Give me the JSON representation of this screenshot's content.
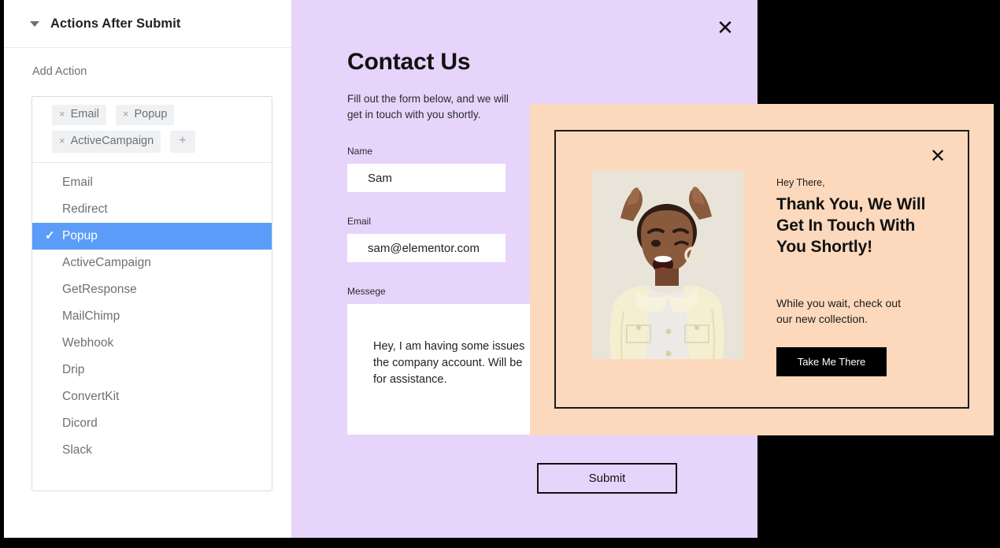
{
  "editor": {
    "header_title": "Actions After Submit",
    "caret_icon": "chevron-down-icon",
    "section_label": "Add Action",
    "tags": [
      {
        "remove_icon": "×",
        "label": "Email"
      },
      {
        "remove_icon": "×",
        "label": "Popup"
      },
      {
        "remove_icon": "×",
        "label": "ActiveCampaign"
      }
    ],
    "add_tag_label": "+",
    "options": [
      {
        "label": "Email",
        "selected": false
      },
      {
        "label": "Redirect",
        "selected": false
      },
      {
        "label": "Popup",
        "selected": true
      },
      {
        "label": "ActiveCampaign",
        "selected": false
      },
      {
        "label": "GetResponse",
        "selected": false
      },
      {
        "label": "MailChimp",
        "selected": false
      },
      {
        "label": "Webhook",
        "selected": false
      },
      {
        "label": "Drip",
        "selected": false
      },
      {
        "label": "ConvertKit",
        "selected": false
      },
      {
        "label": "Dicord",
        "selected": false
      },
      {
        "label": "Slack",
        "selected": false
      }
    ],
    "check_icon": "✓",
    "selected_highlight_color": "#5b9cf8"
  },
  "contact": {
    "background_color": "#e6d4fa",
    "close_icon": "✕",
    "title": "Contact Us",
    "subtitle": "Fill out the form below, and we will get in touch with you shortly.",
    "fields": {
      "name_label": "Name",
      "name_value": "Sam",
      "email_label": "Email",
      "email_value": "sam@elementor.com",
      "message_label": "Messege",
      "message_value": "Hey, I am having some issues with the company account. Will be needing for assistance.",
      "message_line1": "Hey, I am having some issues",
      "message_line2": "the company account. Will be",
      "message_line3": "for assistance."
    },
    "submit_label": "Submit"
  },
  "popup": {
    "background_color": "#fcd9bd",
    "close_icon": "✕",
    "eyebrow": "Hey There,",
    "heading": "Thank You, We Will Get In Touch With You Shortly!",
    "body": "While you wait, check out our new collection.",
    "cta_label": "Take Me There",
    "cta_color": "#000000",
    "image_alt": "woman-cheering-photo"
  }
}
